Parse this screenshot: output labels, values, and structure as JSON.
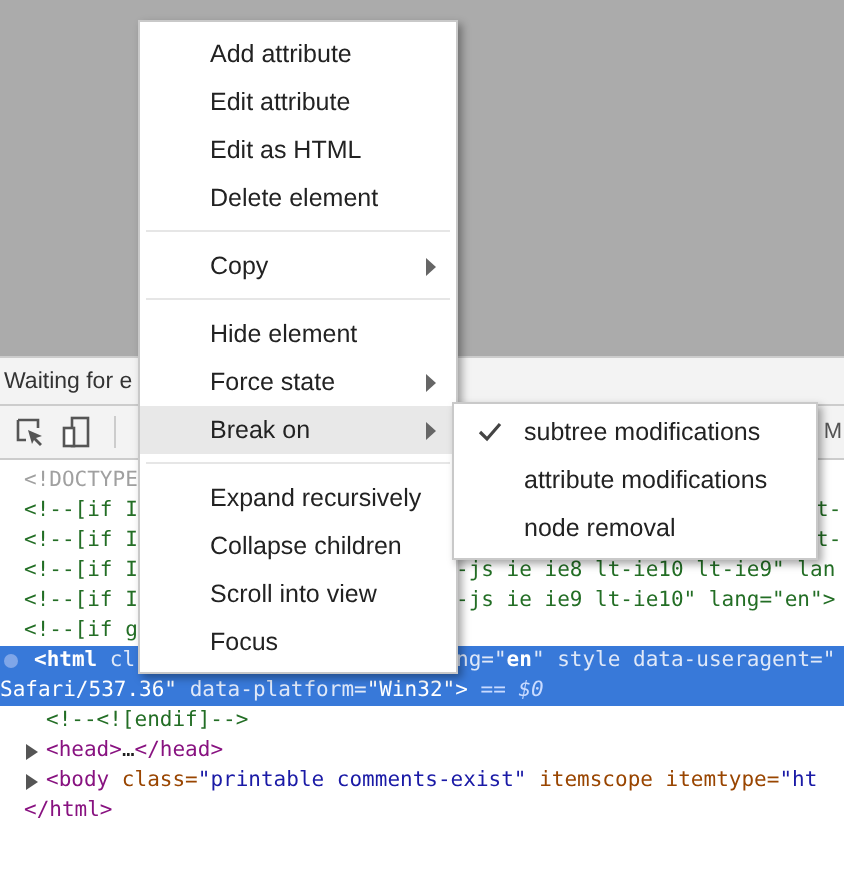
{
  "status_bar": {
    "text": "Waiting for e"
  },
  "toolbar": {
    "tab_label": "M"
  },
  "dom_tree": [
    {
      "left": [
        {
          "text": "<!DOCTYPE",
          "kind": "doctype"
        }
      ]
    },
    {
      "left": [
        {
          "text": "<!--[if I",
          "kind": "comment"
        }
      ],
      "right": [
        {
          "text": "t-",
          "kind": "comment"
        }
      ]
    },
    {
      "left": [
        {
          "text": "<!--[if I",
          "kind": "comment"
        }
      ],
      "right": [
        {
          "text": "t-",
          "kind": "comment"
        }
      ]
    },
    {
      "left": [
        {
          "text": "<!--[if I",
          "kind": "comment"
        }
      ],
      "right": [
        {
          "text": "-js ie ie8 lt-ie10 lt-ie9\" lan",
          "kind": "comment"
        }
      ]
    },
    {
      "left": [
        {
          "text": "<!--[if I",
          "kind": "comment"
        }
      ],
      "right": [
        {
          "text": "-js ie ie9 lt-ie10\" lang=\"en\">",
          "kind": "comment"
        }
      ]
    },
    {
      "left": [
        {
          "text": "<!--[if g",
          "kind": "comment"
        }
      ]
    },
    {
      "selected": true,
      "left": [
        {
          "text": "<html",
          "kind": "tag"
        },
        {
          "text": " cl",
          "kind": "attr"
        }
      ],
      "right": [
        {
          "text": "ng=\"",
          "kind": "attr"
        },
        {
          "text": "en",
          "kind": "value"
        },
        {
          "text": "\" style data-useragent=\"",
          "kind": "attr"
        }
      ],
      "continuation": [
        {
          "text": "Safari/537.36\"",
          "kind": "value"
        },
        {
          "text": " data-platform=",
          "kind": "attr"
        },
        {
          "text": "\"Win32\">",
          "kind": "value"
        },
        {
          "text": " == $0",
          "kind": "marker"
        }
      ],
      "children": [
        {
          "left": [
            {
              "text": "<!--<![endif]-->",
              "kind": "comment"
            }
          ]
        },
        {
          "expandable": true,
          "left": [
            {
              "text": "<head>",
              "kind": "tag"
            },
            {
              "text": "…",
              "kind": "plain"
            },
            {
              "text": "</head>",
              "kind": "tag"
            }
          ]
        },
        {
          "expandable": true,
          "left": [
            {
              "text": "<body",
              "kind": "tag"
            },
            {
              "text": " class=",
              "kind": "attr"
            },
            {
              "text": "\"printable comments-exist\"",
              "kind": "value"
            },
            {
              "text": " itemscope itemtype=",
              "kind": "attr"
            },
            {
              "text": "\"ht",
              "kind": "value"
            }
          ]
        }
      ],
      "closing": [
        {
          "text": "</html>",
          "kind": "tag"
        }
      ]
    }
  ],
  "context_menu": [
    {
      "kind": "item",
      "label": "Add attribute"
    },
    {
      "kind": "item",
      "label": "Edit attribute"
    },
    {
      "kind": "item",
      "label": "Edit as HTML"
    },
    {
      "kind": "item",
      "label": "Delete element"
    },
    {
      "kind": "separator"
    },
    {
      "kind": "submenu",
      "label": "Copy",
      "highlighted": false
    },
    {
      "kind": "separator"
    },
    {
      "kind": "item",
      "label": "Hide element"
    },
    {
      "kind": "submenu",
      "label": "Force state",
      "highlighted": false
    },
    {
      "kind": "submenu",
      "label": "Break on",
      "highlighted": true
    },
    {
      "kind": "separator"
    },
    {
      "kind": "item",
      "label": "Expand recursively"
    },
    {
      "kind": "item",
      "label": "Collapse children"
    },
    {
      "kind": "item",
      "label": "Scroll into view"
    },
    {
      "kind": "item",
      "label": "Focus"
    }
  ],
  "submenu": [
    {
      "label": "subtree modifications",
      "checked": true
    },
    {
      "label": "attribute modifications",
      "checked": false
    },
    {
      "label": "node removal",
      "checked": false
    }
  ]
}
